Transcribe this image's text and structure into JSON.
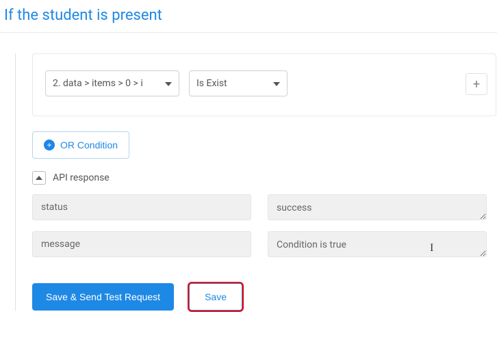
{
  "title": "If the student is present",
  "condition": {
    "field_select": "2. data > items > 0 > i",
    "operator": "Is Exist"
  },
  "or_button": "OR Condition",
  "api_response": {
    "heading": "API response",
    "rows": [
      {
        "key": "status",
        "value": "success"
      },
      {
        "key": "message",
        "value": "Condition is true"
      }
    ]
  },
  "actions": {
    "save_send": "Save & Send Test Request",
    "save": "Save"
  }
}
